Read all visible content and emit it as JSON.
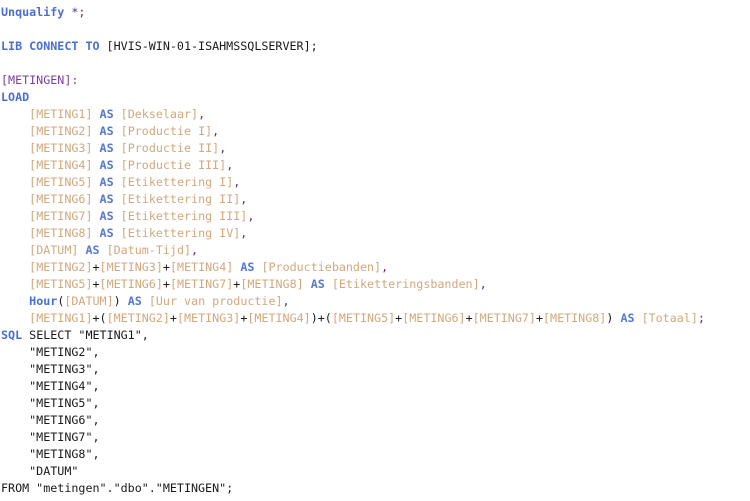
{
  "editor": {
    "background_color": "#ffffff",
    "font_size_px": 11.7,
    "line_height_px": 17,
    "colors": {
      "keyword": "#4a6fd4",
      "function": "#4a6fd4",
      "as_keyword": "#5577cc",
      "table_label": "#7a3f9d",
      "field_name": "#d1a87c",
      "plain_text": "#1a1a1a",
      "punctuation": "#5a2d82"
    }
  },
  "script": {
    "language": "QlikView Load Script",
    "lines": [
      {
        "index": 1,
        "text": "Unqualify *;",
        "tokens": [
          {
            "t": "Unqualify",
            "c": "tok-kw"
          },
          {
            "t": " ",
            "c": "tok-plain"
          },
          {
            "t": "*;",
            "c": "tok-punct"
          }
        ]
      },
      {
        "index": 2,
        "text": "",
        "tokens": []
      },
      {
        "index": 3,
        "text": "LIB CONNECT TO [HVIS-WIN-01-ISAHMSSQLSERVER];",
        "tokens": [
          {
            "t": "LIB CONNECT TO",
            "c": "tok-kw"
          },
          {
            "t": " [HVIS-WIN-01-ISAHMSSQLSERVER];",
            "c": "tok-plain"
          }
        ]
      },
      {
        "index": 4,
        "text": "",
        "tokens": []
      },
      {
        "index": 5,
        "text": "[METINGEN]:",
        "tokens": [
          {
            "t": "[METINGEN]:",
            "c": "tok-label"
          }
        ]
      },
      {
        "index": 6,
        "text": "LOAD",
        "tokens": [
          {
            "t": "LOAD",
            "c": "tok-kw"
          }
        ]
      },
      {
        "index": 7,
        "text": "    [METING1] AS [Dekselaar],",
        "tokens": [
          {
            "t": "    ",
            "c": "tok-plain"
          },
          {
            "t": "[METING1]",
            "c": "tok-field"
          },
          {
            "t": " ",
            "c": "tok-plain"
          },
          {
            "t": "AS",
            "c": "tok-as"
          },
          {
            "t": " ",
            "c": "tok-plain"
          },
          {
            "t": "[Dekselaar]",
            "c": "tok-field"
          },
          {
            "t": ",",
            "c": "tok-punct"
          }
        ]
      },
      {
        "index": 8,
        "text": "    [METING2] AS [Productie I],",
        "tokens": [
          {
            "t": "    ",
            "c": "tok-plain"
          },
          {
            "t": "[METING2]",
            "c": "tok-field"
          },
          {
            "t": " ",
            "c": "tok-plain"
          },
          {
            "t": "AS",
            "c": "tok-as"
          },
          {
            "t": " ",
            "c": "tok-plain"
          },
          {
            "t": "[Productie I]",
            "c": "tok-field"
          },
          {
            "t": ",",
            "c": "tok-punct"
          }
        ]
      },
      {
        "index": 9,
        "text": "    [METING3] AS [Productie II],",
        "tokens": [
          {
            "t": "    ",
            "c": "tok-plain"
          },
          {
            "t": "[METING3]",
            "c": "tok-field"
          },
          {
            "t": " ",
            "c": "tok-plain"
          },
          {
            "t": "AS",
            "c": "tok-as"
          },
          {
            "t": " ",
            "c": "tok-plain"
          },
          {
            "t": "[Productie II]",
            "c": "tok-field"
          },
          {
            "t": ",",
            "c": "tok-punct"
          }
        ]
      },
      {
        "index": 10,
        "text": "    [METING4] AS [Productie III],",
        "tokens": [
          {
            "t": "    ",
            "c": "tok-plain"
          },
          {
            "t": "[METING4]",
            "c": "tok-field"
          },
          {
            "t": " ",
            "c": "tok-plain"
          },
          {
            "t": "AS",
            "c": "tok-as"
          },
          {
            "t": " ",
            "c": "tok-plain"
          },
          {
            "t": "[Productie III]",
            "c": "tok-field"
          },
          {
            "t": ",",
            "c": "tok-punct"
          }
        ]
      },
      {
        "index": 11,
        "text": "    [METING5] AS [Etikettering I],",
        "tokens": [
          {
            "t": "    ",
            "c": "tok-plain"
          },
          {
            "t": "[METING5]",
            "c": "tok-field"
          },
          {
            "t": " ",
            "c": "tok-plain"
          },
          {
            "t": "AS",
            "c": "tok-as"
          },
          {
            "t": " ",
            "c": "tok-plain"
          },
          {
            "t": "[Etikettering I]",
            "c": "tok-field"
          },
          {
            "t": ",",
            "c": "tok-punct"
          }
        ]
      },
      {
        "index": 12,
        "text": "    [METING6] AS [Etikettering II],",
        "tokens": [
          {
            "t": "    ",
            "c": "tok-plain"
          },
          {
            "t": "[METING6]",
            "c": "tok-field"
          },
          {
            "t": " ",
            "c": "tok-plain"
          },
          {
            "t": "AS",
            "c": "tok-as"
          },
          {
            "t": " ",
            "c": "tok-plain"
          },
          {
            "t": "[Etikettering II]",
            "c": "tok-field"
          },
          {
            "t": ",",
            "c": "tok-punct"
          }
        ]
      },
      {
        "index": 13,
        "text": "    [METING7] AS [Etikettering III],",
        "tokens": [
          {
            "t": "    ",
            "c": "tok-plain"
          },
          {
            "t": "[METING7]",
            "c": "tok-field"
          },
          {
            "t": " ",
            "c": "tok-plain"
          },
          {
            "t": "AS",
            "c": "tok-as"
          },
          {
            "t": " ",
            "c": "tok-plain"
          },
          {
            "t": "[Etikettering III]",
            "c": "tok-field"
          },
          {
            "t": ",",
            "c": "tok-punct"
          }
        ]
      },
      {
        "index": 14,
        "text": "    [METING8] AS [Etikettering IV],",
        "tokens": [
          {
            "t": "    ",
            "c": "tok-plain"
          },
          {
            "t": "[METING8]",
            "c": "tok-field"
          },
          {
            "t": " ",
            "c": "tok-plain"
          },
          {
            "t": "AS",
            "c": "tok-as"
          },
          {
            "t": " ",
            "c": "tok-plain"
          },
          {
            "t": "[Etikettering IV]",
            "c": "tok-field"
          },
          {
            "t": ",",
            "c": "tok-punct"
          }
        ]
      },
      {
        "index": 15,
        "text": "    [DATUM] AS [Datum-Tijd],",
        "tokens": [
          {
            "t": "    ",
            "c": "tok-plain"
          },
          {
            "t": "[DATUM]",
            "c": "tok-field"
          },
          {
            "t": " ",
            "c": "tok-plain"
          },
          {
            "t": "AS",
            "c": "tok-as"
          },
          {
            "t": " ",
            "c": "tok-plain"
          },
          {
            "t": "[Datum-Tijd]",
            "c": "tok-field"
          },
          {
            "t": ",",
            "c": "tok-punct"
          }
        ]
      },
      {
        "index": 16,
        "text": "    [METING2]+[METING3]+[METING4] AS [Productiebanden],",
        "tokens": [
          {
            "t": "    ",
            "c": "tok-plain"
          },
          {
            "t": "[METING2]",
            "c": "tok-field"
          },
          {
            "t": "+",
            "c": "tok-op"
          },
          {
            "t": "[METING3]",
            "c": "tok-field"
          },
          {
            "t": "+",
            "c": "tok-op"
          },
          {
            "t": "[METING4]",
            "c": "tok-field"
          },
          {
            "t": " ",
            "c": "tok-plain"
          },
          {
            "t": "AS",
            "c": "tok-as"
          },
          {
            "t": " ",
            "c": "tok-plain"
          },
          {
            "t": "[Productiebanden]",
            "c": "tok-field"
          },
          {
            "t": ",",
            "c": "tok-punct"
          }
        ]
      },
      {
        "index": 17,
        "text": "    [METING5]+[METING6]+[METING7]+[METING8] AS [Etikteringsbanden],",
        "tokens": [
          {
            "t": "    ",
            "c": "tok-plain"
          },
          {
            "t": "[METING5]",
            "c": "tok-field"
          },
          {
            "t": "+",
            "c": "tok-op"
          },
          {
            "t": "[METING6]",
            "c": "tok-field"
          },
          {
            "t": "+",
            "c": "tok-op"
          },
          {
            "t": "[METING7]",
            "c": "tok-field"
          },
          {
            "t": "+",
            "c": "tok-op"
          },
          {
            "t": "[METING8]",
            "c": "tok-field"
          },
          {
            "t": " ",
            "c": "tok-plain"
          },
          {
            "t": "AS",
            "c": "tok-as"
          },
          {
            "t": " ",
            "c": "tok-plain"
          },
          {
            "t": "[Etiketteringsbanden]",
            "c": "tok-field"
          },
          {
            "t": ",",
            "c": "tok-punct"
          }
        ]
      },
      {
        "index": 18,
        "text": "    Hour([DATUM]) AS [Uur van productie],",
        "tokens": [
          {
            "t": "    ",
            "c": "tok-plain"
          },
          {
            "t": "Hour",
            "c": "tok-fn"
          },
          {
            "t": "(",
            "c": "tok-op"
          },
          {
            "t": "[DATUM]",
            "c": "tok-field"
          },
          {
            "t": ")",
            "c": "tok-op"
          },
          {
            "t": " ",
            "c": "tok-plain"
          },
          {
            "t": "AS",
            "c": "tok-as"
          },
          {
            "t": " ",
            "c": "tok-plain"
          },
          {
            "t": "[Uur van productie]",
            "c": "tok-field"
          },
          {
            "t": ",",
            "c": "tok-punct"
          }
        ]
      },
      {
        "index": 19,
        "text": "    [METING1]+([METING2]+[METING3]+[METING4])+([METING5]+[METING6]+[METING7]+[METING8]) AS [Totaal];",
        "tokens": [
          {
            "t": "    ",
            "c": "tok-plain"
          },
          {
            "t": "[METING1]",
            "c": "tok-field"
          },
          {
            "t": "+(",
            "c": "tok-op"
          },
          {
            "t": "[METING2]",
            "c": "tok-field"
          },
          {
            "t": "+",
            "c": "tok-op"
          },
          {
            "t": "[METING3]",
            "c": "tok-field"
          },
          {
            "t": "+",
            "c": "tok-op"
          },
          {
            "t": "[METING4]",
            "c": "tok-field"
          },
          {
            "t": ")+(",
            "c": "tok-op"
          },
          {
            "t": "[METING5]",
            "c": "tok-field"
          },
          {
            "t": "+",
            "c": "tok-op"
          },
          {
            "t": "[METING6]",
            "c": "tok-field"
          },
          {
            "t": "+",
            "c": "tok-op"
          },
          {
            "t": "[METING7]",
            "c": "tok-field"
          },
          {
            "t": "+",
            "c": "tok-op"
          },
          {
            "t": "[METING8]",
            "c": "tok-field"
          },
          {
            "t": ")",
            "c": "tok-op"
          },
          {
            "t": " ",
            "c": "tok-plain"
          },
          {
            "t": "AS",
            "c": "tok-as"
          },
          {
            "t": " ",
            "c": "tok-plain"
          },
          {
            "t": "[Totaal]",
            "c": "tok-field"
          },
          {
            "t": ";",
            "c": "tok-punct"
          }
        ]
      },
      {
        "index": 20,
        "text": "SQL SELECT \"METING1\",",
        "tokens": [
          {
            "t": "SQL",
            "c": "tok-sqlkw"
          },
          {
            "t": " SELECT \"METING1\",",
            "c": "tok-plain"
          }
        ]
      },
      {
        "index": 21,
        "text": "    \"METING2\",",
        "tokens": [
          {
            "t": "    \"METING2\",",
            "c": "tok-plain"
          }
        ]
      },
      {
        "index": 22,
        "text": "    \"METING3\",",
        "tokens": [
          {
            "t": "    \"METING3\",",
            "c": "tok-plain"
          }
        ]
      },
      {
        "index": 23,
        "text": "    \"METING4\",",
        "tokens": [
          {
            "t": "    \"METING4\",",
            "c": "tok-plain"
          }
        ]
      },
      {
        "index": 24,
        "text": "    \"METING5\",",
        "tokens": [
          {
            "t": "    \"METING5\",",
            "c": "tok-plain"
          }
        ]
      },
      {
        "index": 25,
        "text": "    \"METING6\",",
        "tokens": [
          {
            "t": "    \"METING6\",",
            "c": "tok-plain"
          }
        ]
      },
      {
        "index": 26,
        "text": "    \"METING7\",",
        "tokens": [
          {
            "t": "    \"METING7\",",
            "c": "tok-plain"
          }
        ]
      },
      {
        "index": 27,
        "text": "    \"METING8\",",
        "tokens": [
          {
            "t": "    \"METING8\",",
            "c": "tok-plain"
          }
        ]
      },
      {
        "index": 28,
        "text": "    \"DATUM\"",
        "tokens": [
          {
            "t": "    \"DATUM\"",
            "c": "tok-plain"
          }
        ]
      },
      {
        "index": 29,
        "text": "FROM \"metingen\".\"dbo\".\"METINGEN\";",
        "tokens": [
          {
            "t": "FROM \"metingen\".\"dbo\".\"METINGEN\";",
            "c": "tok-plain"
          }
        ]
      }
    ]
  }
}
